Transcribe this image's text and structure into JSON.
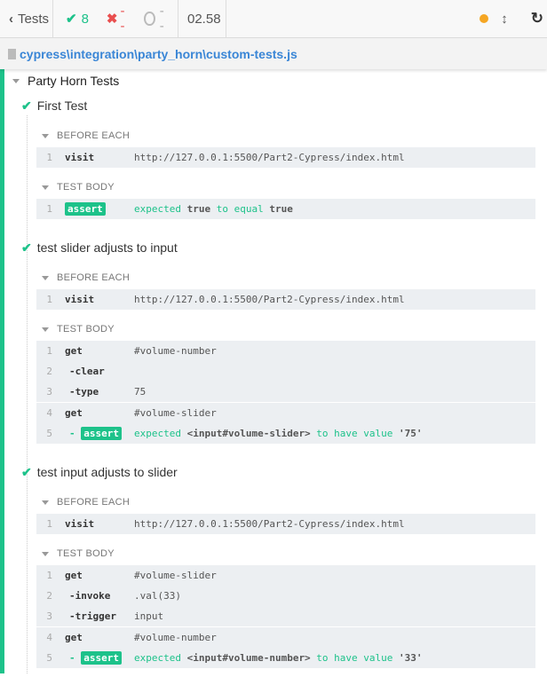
{
  "header": {
    "back_label": "Tests",
    "passed": "8",
    "failed": "--",
    "pending": "--",
    "duration": "02.58"
  },
  "file_path": "cypress\\integration\\party_horn\\custom-tests.js",
  "suite_title": "Party Horn Tests",
  "colors": {
    "pass": "#1dc28a",
    "running": "#f5a623",
    "link": "#3a86d6",
    "fail": "#e94f4f"
  },
  "tests": [
    {
      "title": "First Test",
      "hooks": [
        {
          "label": "BEFORE EACH",
          "groups": [
            [
              {
                "n": "1",
                "name": "visit",
                "msg": "http://127.0.0.1:5500/Part2-Cypress/index.html"
              }
            ]
          ]
        },
        {
          "label": "TEST BODY",
          "groups": [
            [
              {
                "n": "1",
                "name": "assert",
                "badge": true,
                "parts": [
                  [
                    "g",
                    "expected "
                  ],
                  [
                    "b",
                    "true"
                  ],
                  [
                    "g",
                    " to equal "
                  ],
                  [
                    "b",
                    "true"
                  ]
                ]
              }
            ]
          ]
        }
      ]
    },
    {
      "title": "test slider adjusts to input",
      "hooks": [
        {
          "label": "BEFORE EACH",
          "groups": [
            [
              {
                "n": "1",
                "name": "visit",
                "msg": "http://127.0.0.1:5500/Part2-Cypress/index.html"
              }
            ]
          ]
        },
        {
          "label": "TEST BODY",
          "groups": [
            [
              {
                "n": "1",
                "name": "get",
                "msg": "#volume-number"
              },
              {
                "n": "2",
                "name": "-clear",
                "child": true,
                "msg": ""
              },
              {
                "n": "3",
                "name": "-type",
                "child": true,
                "msg": "75"
              }
            ],
            [
              {
                "n": "4",
                "name": "get",
                "msg": "#volume-slider"
              },
              {
                "n": "5",
                "name": "assert",
                "badge": true,
                "child": true,
                "parts": [
                  [
                    "g",
                    "expected "
                  ],
                  [
                    "b",
                    "<input#volume-slider>"
                  ],
                  [
                    "g",
                    " to have value "
                  ],
                  [
                    "b",
                    "'75'"
                  ]
                ]
              }
            ]
          ]
        }
      ]
    },
    {
      "title": "test input adjusts to slider",
      "hooks": [
        {
          "label": "BEFORE EACH",
          "groups": [
            [
              {
                "n": "1",
                "name": "visit",
                "msg": "http://127.0.0.1:5500/Part2-Cypress/index.html"
              }
            ]
          ]
        },
        {
          "label": "TEST BODY",
          "groups": [
            [
              {
                "n": "1",
                "name": "get",
                "msg": "#volume-slider"
              },
              {
                "n": "2",
                "name": "-invoke",
                "child": true,
                "msg": ".val(33)"
              },
              {
                "n": "3",
                "name": "-trigger",
                "child": true,
                "msg": "input"
              }
            ],
            [
              {
                "n": "4",
                "name": "get",
                "msg": "#volume-number"
              },
              {
                "n": "5",
                "name": "assert",
                "badge": true,
                "child": true,
                "parts": [
                  [
                    "g",
                    "expected "
                  ],
                  [
                    "b",
                    "<input#volume-number>"
                  ],
                  [
                    "g",
                    " to have value "
                  ],
                  [
                    "b",
                    "'33'"
                  ]
                ]
              }
            ]
          ]
        }
      ]
    }
  ]
}
